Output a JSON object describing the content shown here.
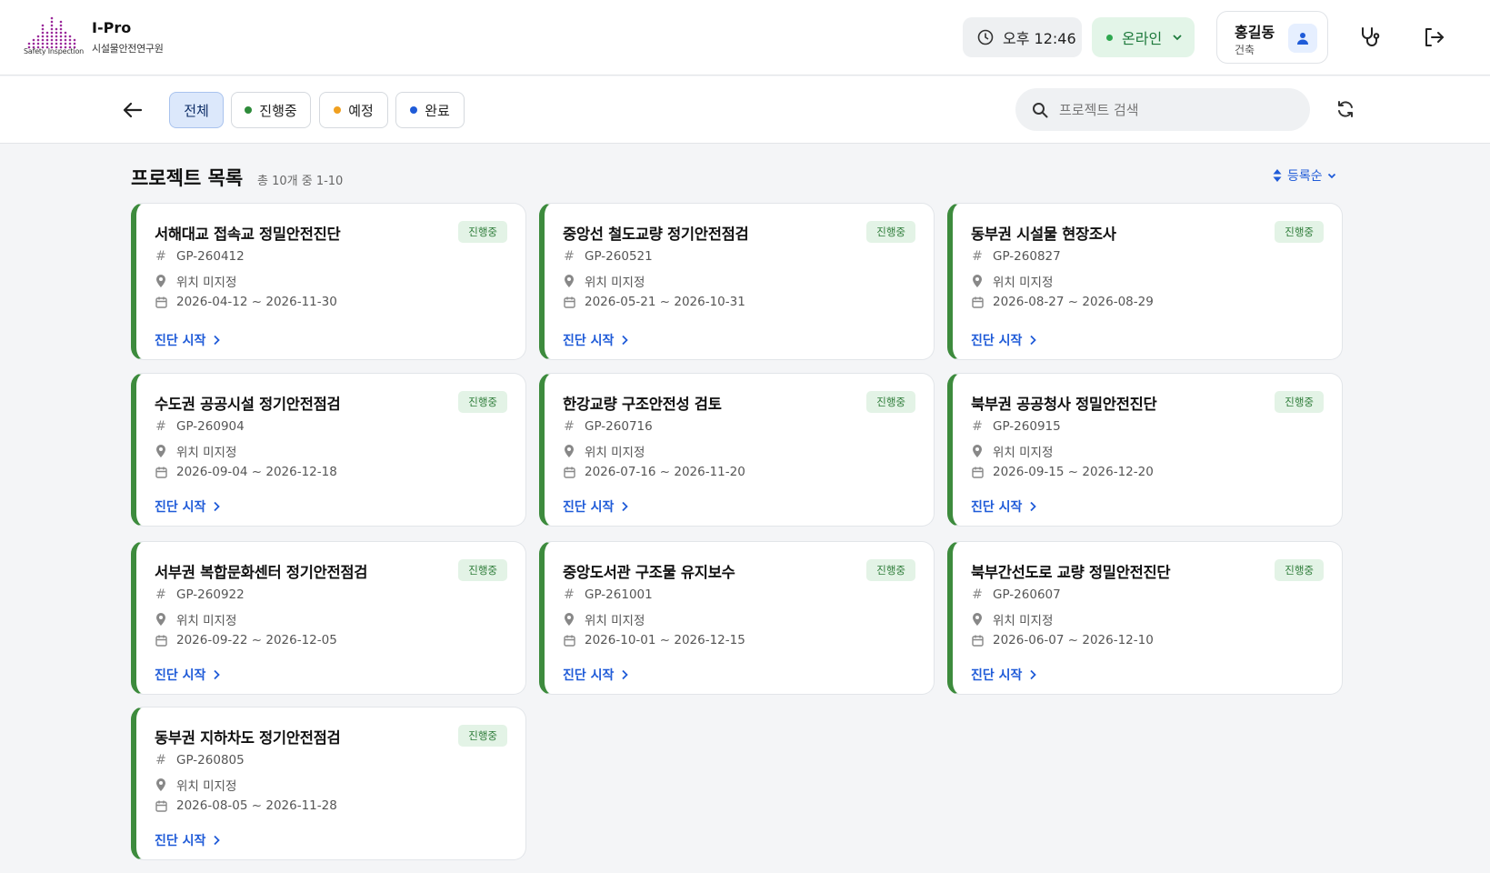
{
  "header": {
    "logo_text": "Safety Inspection",
    "app_title": "I-Pro",
    "app_subtitle": "시설물안전연구원",
    "time": "오후 12:46",
    "status": "온라인",
    "user_name": "홍길동",
    "user_role": "건축"
  },
  "toolbar": {
    "filters": [
      {
        "label": "전체",
        "dot": ""
      },
      {
        "label": "진행중",
        "dot": "#2e8b3a"
      },
      {
        "label": "예정",
        "dot": "#f0a020"
      },
      {
        "label": "완료",
        "dot": "#1f5bd8"
      }
    ],
    "search_placeholder": "프로젝트 검색"
  },
  "list": {
    "title": "프로젝트 목록",
    "count": "총 10개 중 1-10",
    "sort": "등록순"
  },
  "colors": {
    "accent": "#1f5bd8",
    "in_progress": "#3d8b3d",
    "online": "#2ea84f"
  },
  "projects": [
    {
      "title": "서해대교 접속교 정밀안전진단",
      "status": "진행중",
      "code": "GP-260412",
      "location": "위치 미지정",
      "period": "2026-04-12 ~ 2026-11-30",
      "action": "진단 시작"
    },
    {
      "title": "중앙선 철도교량 정기안전점검",
      "status": "진행중",
      "code": "GP-260521",
      "location": "위치 미지정",
      "period": "2026-05-21 ~ 2026-10-31",
      "action": "진단 시작"
    },
    {
      "title": "동부권 시설물 현장조사",
      "status": "진행중",
      "code": "GP-260827",
      "location": "위치 미지정",
      "period": "2026-08-27 ~ 2026-08-29",
      "action": "진단 시작"
    },
    {
      "title": "수도권 공공시설 정기안전점검",
      "status": "진행중",
      "code": "GP-260904",
      "location": "위치 미지정",
      "period": "2026-09-04 ~ 2026-12-18",
      "action": "진단 시작"
    },
    {
      "title": "한강교량 구조안전성 검토",
      "status": "진행중",
      "code": "GP-260716",
      "location": "위치 미지정",
      "period": "2026-07-16 ~ 2026-11-20",
      "action": "진단 시작"
    },
    {
      "title": "북부권 공공청사 정밀안전진단",
      "status": "진행중",
      "code": "GP-260915",
      "location": "위치 미지정",
      "period": "2026-09-15 ~ 2026-12-20",
      "action": "진단 시작"
    },
    {
      "title": "서부권 복합문화센터 정기안전점검",
      "status": "진행중",
      "code": "GP-260922",
      "location": "위치 미지정",
      "period": "2026-09-22 ~ 2026-12-05",
      "action": "진단 시작"
    },
    {
      "title": "중앙도서관 구조물 유지보수",
      "status": "진행중",
      "code": "GP-261001",
      "location": "위치 미지정",
      "period": "2026-10-01 ~ 2026-12-15",
      "action": "진단 시작"
    },
    {
      "title": "북부간선도로 교량 정밀안전진단",
      "status": "진행중",
      "code": "GP-260607",
      "location": "위치 미지정",
      "period": "2026-06-07 ~ 2026-12-10",
      "action": "진단 시작"
    },
    {
      "title": "동부권 지하차도 정기안전점검",
      "status": "진행중",
      "code": "GP-260805",
      "location": "위치 미지정",
      "period": "2026-08-05 ~ 2026-11-28",
      "action": "진단 시작"
    }
  ]
}
